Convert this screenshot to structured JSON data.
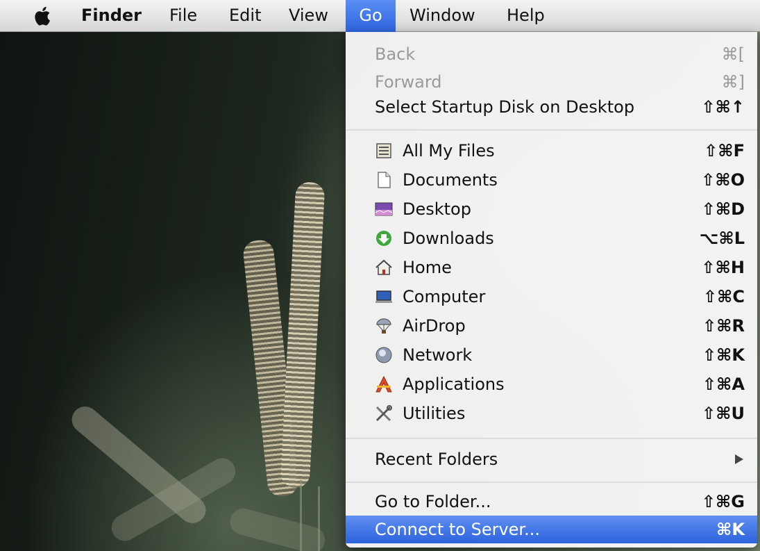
{
  "menubar": {
    "app_name": "Finder",
    "items": [
      "File",
      "Edit",
      "View",
      "Go",
      "Window",
      "Help"
    ]
  },
  "go_menu": {
    "nav": [
      {
        "label": "Back",
        "shortcut": "⌘[",
        "enabled": false
      },
      {
        "label": "Forward",
        "shortcut": "⌘]",
        "enabled": false
      },
      {
        "label": "Select Startup Disk on Desktop",
        "shortcut": "⇧⌘↑",
        "enabled": true
      }
    ],
    "places": [
      {
        "label": "All My Files",
        "shortcut": "⇧⌘F",
        "icon": "all-my-files-icon"
      },
      {
        "label": "Documents",
        "shortcut": "⇧⌘O",
        "icon": "documents-icon"
      },
      {
        "label": "Desktop",
        "shortcut": "⇧⌘D",
        "icon": "desktop-icon"
      },
      {
        "label": "Downloads",
        "shortcut": "⌥⌘L",
        "icon": "downloads-icon"
      },
      {
        "label": "Home",
        "shortcut": "⇧⌘H",
        "icon": "home-icon"
      },
      {
        "label": "Computer",
        "shortcut": "⇧⌘C",
        "icon": "computer-icon"
      },
      {
        "label": "AirDrop",
        "shortcut": "⇧⌘R",
        "icon": "airdrop-icon"
      },
      {
        "label": "Network",
        "shortcut": "⇧⌘K",
        "icon": "network-icon"
      },
      {
        "label": "Applications",
        "shortcut": "⇧⌘A",
        "icon": "applications-icon"
      },
      {
        "label": "Utilities",
        "shortcut": "⇧⌘U",
        "icon": "utilities-icon"
      }
    ],
    "recent_folders": {
      "label": "Recent Folders"
    },
    "go_to_folder": {
      "label": "Go to Folder...",
      "shortcut": "⇧⌘G"
    },
    "connect_to_server": {
      "label": "Connect to Server...",
      "shortcut": "⌘K",
      "highlighted": true
    }
  },
  "colors": {
    "highlight": "#2d63dd",
    "menu_bg": "#f6f6f6",
    "disabled_text": "#9a9a9a"
  }
}
